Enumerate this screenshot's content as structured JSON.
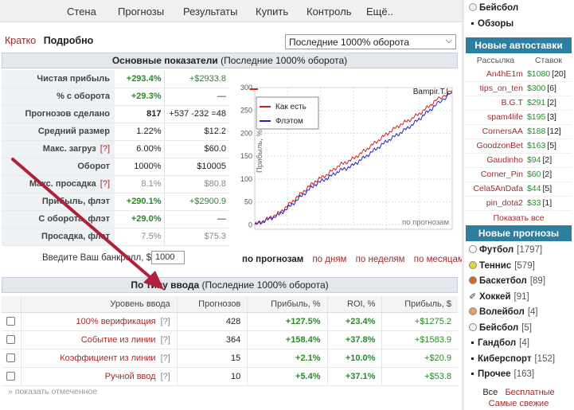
{
  "nav": [
    "Стена",
    "Прогнозы",
    "Результаты",
    "Купить",
    "Контроль",
    "Ещё.."
  ],
  "view_tabs": {
    "brief": "Кратко",
    "detail": "Подробно"
  },
  "period_select": "Последние 1000% оборота",
  "main_section": {
    "title": "Основные показатели",
    "subtitle": "(Последние 1000% оборота)"
  },
  "stats": [
    {
      "label": "Чистая прибыль",
      "v1": "+293.4%",
      "v2": "+$2933.8"
    },
    {
      "label": "% с оборота",
      "v1": "+29.3%",
      "v2": "—"
    },
    {
      "label": "Прогнозов сделано",
      "v1": "817",
      "v2": "+537 -232 =48"
    },
    {
      "label": "Средний размер",
      "v1": "1.22%",
      "v2": "$12.2"
    },
    {
      "label": "Макс. загруз",
      "help": "[?]",
      "v1": "6.00%",
      "v2": "$60.0"
    },
    {
      "label": "Оборот",
      "v1": "1000%",
      "v2": "$10005"
    },
    {
      "label": "Макс. просадка",
      "help": "[?]",
      "v1": "8.1%",
      "v2": "$80.8"
    },
    {
      "label": "Прибыль, флэт",
      "v1": "+290.1%",
      "v2": "+$2900.9"
    },
    {
      "label": "С оборота, флэт",
      "v1": "+29.0%",
      "v2": "—"
    },
    {
      "label": "Просадка, флэт",
      "v1": "7.5%",
      "v2": "$75.3"
    }
  ],
  "bankroll": {
    "label": "Введите Ваш банкролл, $",
    "value": "1000"
  },
  "chart_links": [
    "по прогнозам",
    "по дням",
    "по неделям",
    "по месяцам"
  ],
  "chart_data": {
    "type": "line",
    "title": "Bampir.T.L",
    "ylabel": "Прибыль, %",
    "xlabel": "по прогнозам",
    "ylim": [
      -10,
      300
    ],
    "yticks": [
      0,
      50,
      100,
      150,
      200,
      250,
      300
    ],
    "x": [
      0,
      50,
      100,
      150,
      200,
      250,
      300,
      350,
      400,
      450,
      500,
      550,
      600,
      650,
      700,
      750,
      817
    ],
    "series": [
      {
        "name": "Как есть",
        "color": "#cc2222",
        "values": [
          0,
          12,
          25,
          48,
          72,
          95,
          110,
          130,
          142,
          160,
          180,
          200,
          218,
          232,
          250,
          272,
          293
        ]
      },
      {
        "name": "Флэтом",
        "color": "#2222bb",
        "values": [
          0,
          10,
          22,
          42,
          66,
          88,
          102,
          118,
          128,
          146,
          165,
          184,
          200,
          218,
          240,
          262,
          290
        ]
      }
    ],
    "legend_position": "top-left",
    "grid": true
  },
  "type_section": {
    "title": "По типу ввода",
    "subtitle": "(Последние 1000% оборота)"
  },
  "type_table": {
    "headers": [
      "Уровень ввода",
      "Прогнозов",
      "Прибыль, %",
      "ROI, %",
      "Прибыль, $"
    ],
    "rows": [
      {
        "level": "100% верификация",
        "help": "[?]",
        "count": "428",
        "profit_pct": "+127.5%",
        "roi": "+23.4%",
        "profit_usd": "+$1275.2"
      },
      {
        "level": "Событие из линии",
        "help": "[?]",
        "count": "364",
        "profit_pct": "+158.4%",
        "roi": "+37.8%",
        "profit_usd": "+$1583.9"
      },
      {
        "level": "Коэффициент из линии",
        "help": "[?]",
        "count": "15",
        "profit_pct": "+2.1%",
        "roi": "+10.0%",
        "profit_usd": "+$20.9"
      },
      {
        "level": "Ручной ввод",
        "help": "[?]",
        "count": "10",
        "profit_pct": "+5.4%",
        "roi": "+37.1%",
        "profit_usd": "+$53.8"
      }
    ]
  },
  "show_selected": "» показать отмеченное",
  "sidebar_top": [
    "Бейсбол",
    "Обзоры"
  ],
  "new_bets": {
    "title": "Новые автоставки",
    "headers": [
      "Рассылка",
      "Ставок"
    ],
    "rows": [
      {
        "name": "An4hE1m",
        "amount": "$1080",
        "count": "[20]"
      },
      {
        "name": "tips_on_ten",
        "amount": "$300",
        "count": "[6]"
      },
      {
        "name": "B.G.T",
        "amount": "$291",
        "count": "[2]"
      },
      {
        "name": "spam4life",
        "amount": "$195",
        "count": "[3]"
      },
      {
        "name": "CornersAA",
        "amount": "$188",
        "count": "[12]"
      },
      {
        "name": "GoodzonBet",
        "amount": "$163",
        "count": "[5]"
      },
      {
        "name": "Gaudinho",
        "amount": "$94",
        "count": "[2]"
      },
      {
        "name": "Corner_Pin",
        "amount": "$60",
        "count": "[2]"
      },
      {
        "name": "Cela5AnDafa",
        "amount": "$44",
        "count": "[5]"
      },
      {
        "name": "pin_dota2",
        "amount": "$33",
        "count": "[1]"
      }
    ],
    "show_all": "Показать все"
  },
  "new_predictions": {
    "title": "Новые прогнозы",
    "sports": [
      {
        "name": "Футбол",
        "count": "[1797]",
        "icon": "soccer-ball",
        "color": "#ffffff"
      },
      {
        "name": "Теннис",
        "count": "[579]",
        "icon": "tennis-ball",
        "color": "#e8d23a"
      },
      {
        "name": "Баскетбол",
        "count": "[89]",
        "icon": "basketball",
        "color": "#d7661e"
      },
      {
        "name": "Хоккей",
        "count": "[91]",
        "icon": "hockey-stick",
        "color": "#333333"
      },
      {
        "name": "Волейбол",
        "count": "[4]",
        "icon": "volleyball",
        "color": "#e8a060"
      },
      {
        "name": "Бейсбол",
        "count": "[5]",
        "icon": "baseball",
        "color": "#eeeeee"
      },
      {
        "name": "Гандбол",
        "count": "[4]",
        "icon": "bullet",
        "color": "#222222"
      },
      {
        "name": "Киберспорт",
        "count": "[152]",
        "icon": "bullet",
        "color": "#222222"
      },
      {
        "name": "Прочее",
        "count": "[163]",
        "icon": "bullet",
        "color": "#222222"
      }
    ]
  },
  "footer": {
    "all": "Все",
    "free": "Бесплатные",
    "fresh": "Самые свежие"
  }
}
